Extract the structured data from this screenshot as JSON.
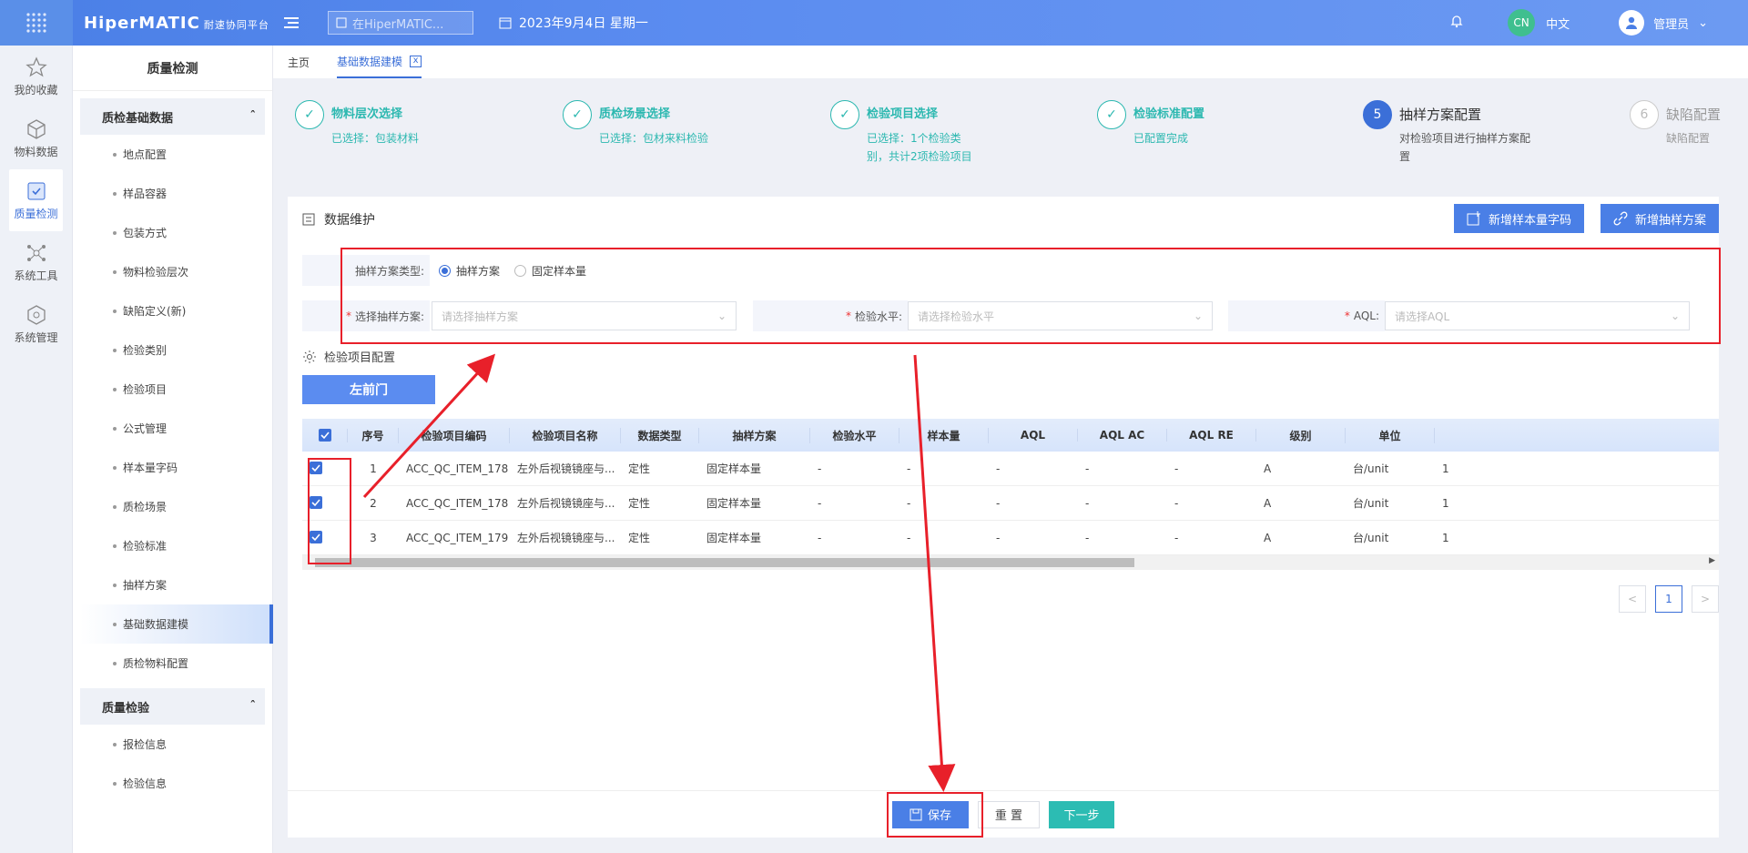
{
  "topbar": {
    "brand": "HiperMATIC",
    "brand_sub": "耐速协同平台",
    "search_placeholder": "在HiperMATIC...",
    "date": "2023年9月4日 星期一",
    "lang_badge": "CN",
    "lang_label": "中文",
    "user_name": "管理员"
  },
  "rail": [
    {
      "label": "我的收藏",
      "icon": "star-icon"
    },
    {
      "label": "物料数据",
      "icon": "cube-icon"
    },
    {
      "label": "质量检测",
      "icon": "shield-icon"
    },
    {
      "label": "系统工具",
      "icon": "network-icon"
    },
    {
      "label": "系统管理",
      "icon": "hexagon-icon"
    }
  ],
  "sidebar": {
    "title": "质量检测",
    "group1": "质检基础数据",
    "items1": [
      "地点配置",
      "样品容器",
      "包装方式",
      "物料检验层次",
      "缺陷定义(新)",
      "检验类别",
      "检验项目",
      "公式管理",
      "样本量字码",
      "质检场景",
      "检验标准",
      "抽样方案",
      "基础数据建模",
      "质检物料配置"
    ],
    "group2": "质量检验",
    "items2": [
      "报检信息",
      "检验信息"
    ]
  },
  "tabs": {
    "home": "主页",
    "active": "基础数据建模",
    "close": "x"
  },
  "steps": [
    {
      "title": "物料层次选择",
      "desc": "已选择：包装材料"
    },
    {
      "title": "质检场景选择",
      "desc": "已选择：包材来料检验"
    },
    {
      "title": "检验项目选择",
      "desc": "已选择：1个检验类别，共计2项检验项目"
    },
    {
      "title": "检验标准配置",
      "desc": "已配置完成"
    },
    {
      "num": "5",
      "title": "抽样方案配置",
      "desc": "对检验项目进行抽样方案配置"
    },
    {
      "num": "6",
      "title": "缺陷配置",
      "desc": "缺陷配置"
    }
  ],
  "card": {
    "title": "数据维护",
    "btn_add_code": "新增样本量字码",
    "btn_add_plan": "新增抽样方案",
    "plan_type_label": "抽样方案类型:",
    "radio_plan": "抽样方案",
    "radio_fixed": "固定样本量",
    "select_plan_label": "选择抽样方案:",
    "select_plan_placeholder": "请选择抽样方案",
    "level_label": "检验水平:",
    "level_placeholder": "请选择检验水平",
    "aql_label": "AQL:",
    "aql_placeholder": "请选择AQL",
    "config_title": "检验项目配置",
    "door_btn": "左前门"
  },
  "table": {
    "headers": [
      "序号",
      "检验项目编码",
      "检验项目名称",
      "数据类型",
      "抽样方案",
      "检验水平",
      "样本量",
      "AQL",
      "AQL AC",
      "AQL RE",
      "级别",
      "单位"
    ],
    "rows": [
      [
        "1",
        "ACC_QC_ITEM_178",
        "左外后视镜镜座与...",
        "定性",
        "固定样本量",
        "-",
        "-",
        "-",
        "-",
        "-",
        "A",
        "台/unit",
        "1"
      ],
      [
        "2",
        "ACC_QC_ITEM_178",
        "左外后视镜镜座与...",
        "定性",
        "固定样本量",
        "-",
        "-",
        "-",
        "-",
        "-",
        "A",
        "台/unit",
        "1"
      ],
      [
        "3",
        "ACC_QC_ITEM_179",
        "左外后视镜镜座与...",
        "定性",
        "固定样本量",
        "-",
        "-",
        "-",
        "-",
        "-",
        "A",
        "台/unit",
        "1"
      ]
    ]
  },
  "pager": {
    "prev": "<",
    "page": "1",
    "next": ">"
  },
  "footer": {
    "save": "保存",
    "reset": "重 置",
    "next": "下一步"
  },
  "colors": {
    "accent": "#3b6fd8",
    "teal": "#2cb8b0",
    "annotation": "#e8202a"
  }
}
